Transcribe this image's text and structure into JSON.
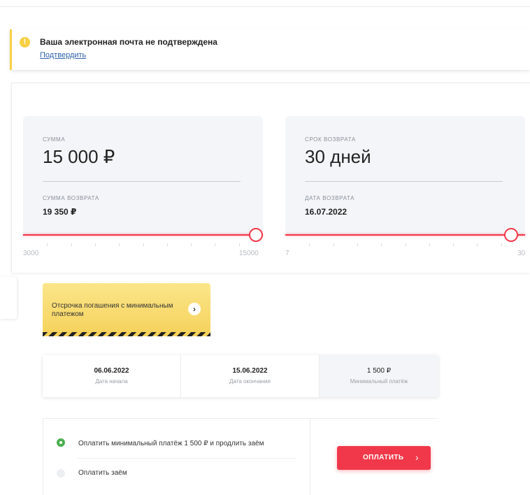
{
  "alert": {
    "icon": "exclamation-icon",
    "title": "Ваша электронная почта не подтверждена",
    "link": "Подтвердить",
    "accent_color": "#f7d044"
  },
  "calculator": {
    "amount": {
      "label": "СУММА",
      "value": "15 000 ₽",
      "return_label": "СУММА ВОЗВРАТА",
      "return_value": "19 350 ₽",
      "slider": {
        "min": 3000,
        "max": 15000,
        "value": 15000,
        "min_label": "3000",
        "max_label": "15000"
      }
    },
    "term": {
      "label": "СРОК ВОЗВРАТА",
      "value": "30 дней",
      "return_label": "ДАТА ВОЗВРАТА",
      "return_value": "16.07.2022",
      "slider": {
        "min": 7,
        "max": 30,
        "value": 30,
        "min_label": "7",
        "max_label": "30"
      }
    },
    "slider_color": "#f1384a"
  },
  "deferral": {
    "text": "Отсрочка погашения с минимальным платежом",
    "arrow_icon": "chevron-right-icon",
    "color": "#f5d15a"
  },
  "dates": [
    {
      "value": "06.06.2022",
      "caption": "Дата начала"
    },
    {
      "value": "15.06.2022",
      "caption": "Дата окончания"
    },
    {
      "value": "1 500 ₽",
      "caption": "Минимальный платёж"
    }
  ],
  "payment": {
    "options": [
      {
        "label": "Оплатить минимальный платёж 1 500 ₽ и продлить заём",
        "selected": true
      },
      {
        "label": "Оплатить заём",
        "selected": false
      }
    ],
    "button_label": "ОПЛАТИТЬ",
    "button_icon": "chevron-right-icon",
    "accent_color": "#f1384a",
    "selected_color": "#4caf50"
  }
}
